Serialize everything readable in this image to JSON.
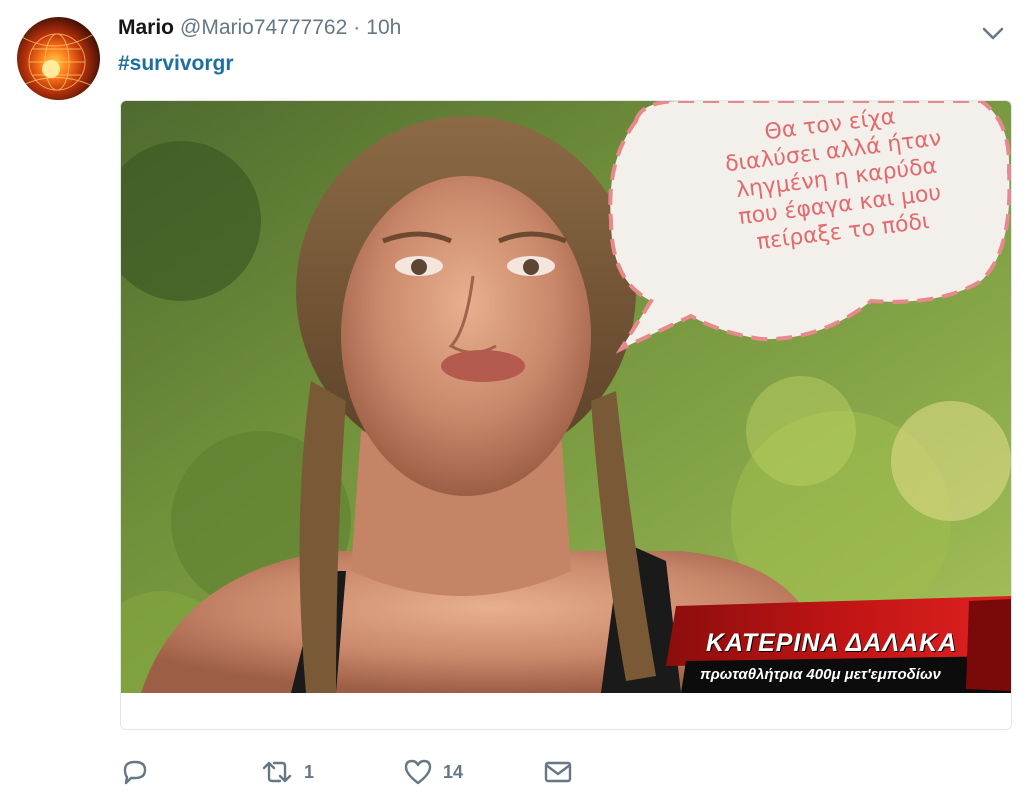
{
  "tweet": {
    "author_name": "Mario",
    "handle": "@Mario74777762",
    "separator": "·",
    "time": "10h",
    "hashtag": "#survivorgr"
  },
  "image": {
    "speech_bubble_lines": [
      "Θα τον είχα",
      "διαλύσει αλλά ήταν",
      "ληγμένη η καρύδα",
      "που έφαγα και μου",
      "πείραξε το πόδι"
    ],
    "caption_name": "ΚΑΤΕΡΙΝΑ ΔΑΛΑΚΑ",
    "caption_subtitle": "πρωταθλήτρια 400μ μετ'εμποδίων"
  },
  "actions": {
    "reply_icon": "reply-icon",
    "retweet_icon": "retweet-icon",
    "retweet_count": "1",
    "like_icon": "heart-icon",
    "like_count": "14",
    "message_icon": "envelope-icon"
  },
  "colors": {
    "link": "#1c6f9e",
    "muted": "#657786",
    "bubble_text": "#e26a6e",
    "bubble_border": "#e7898c",
    "banner_red": "#d11a1a"
  }
}
